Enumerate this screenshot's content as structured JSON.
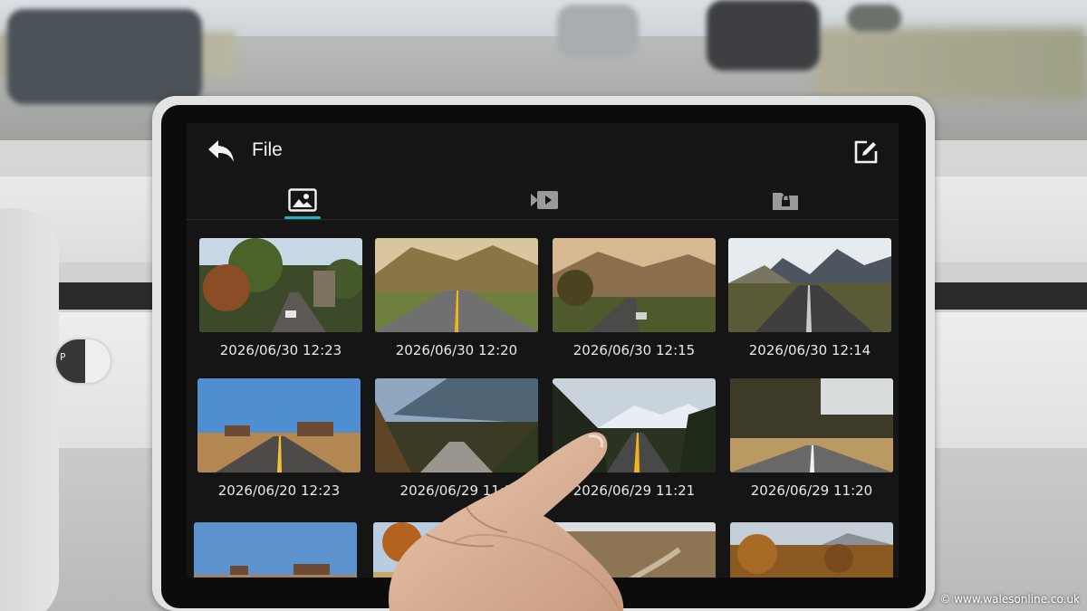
{
  "screen": {
    "title": "File",
    "tabs": [
      {
        "icon": "photo-icon",
        "active": true
      },
      {
        "icon": "video-icon",
        "active": false
      },
      {
        "icon": "locked-folder-icon",
        "active": false
      }
    ],
    "files": [
      {
        "caption": "2026/06/30 12:23",
        "scene": "town-road"
      },
      {
        "caption": "2026/06/30 12:20",
        "scene": "hill-road"
      },
      {
        "caption": "2026/06/30 12:15",
        "scene": "valley-road"
      },
      {
        "caption": "2026/06/30 12:14",
        "scene": "mountain-highway"
      },
      {
        "caption": "2026/06/20 12:23",
        "scene": "desert-mesa-road"
      },
      {
        "caption": "2026/06/29 11:2",
        "scene": "forest-mountain-road"
      },
      {
        "caption": "2026/06/29 11:21",
        "scene": "snowy-peak-road"
      },
      {
        "caption": "2026/06/29 11:20",
        "scene": "autumn-forest-road"
      },
      {
        "caption": "",
        "scene": "blue-sky-mesa"
      },
      {
        "caption": "",
        "scene": "lone-tree"
      },
      {
        "caption": "",
        "scene": "winding-plain"
      },
      {
        "caption": "",
        "scene": "autumn-hills"
      }
    ],
    "accent_color": "#1fb3c7"
  },
  "car": {
    "stalk_label": "P",
    "watermark": "© www.walesonline.co.uk"
  }
}
